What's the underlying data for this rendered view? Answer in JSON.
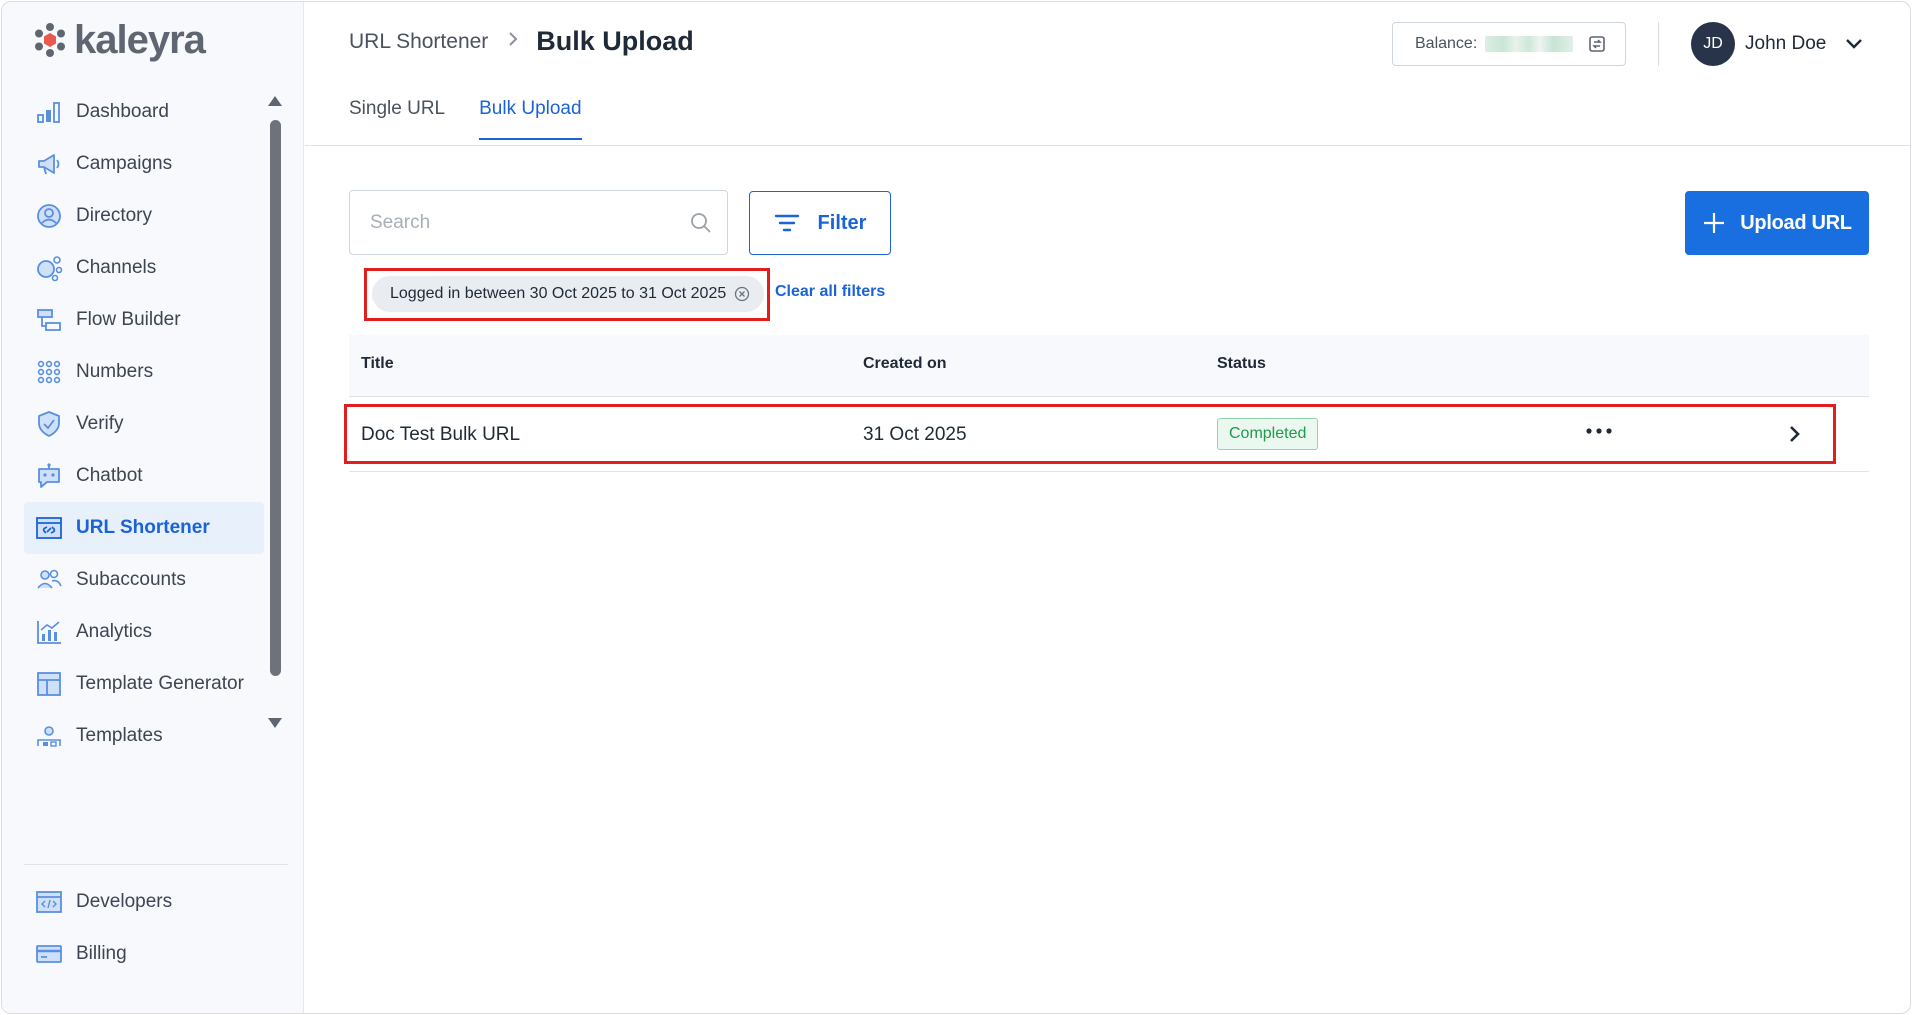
{
  "brand": {
    "name": "kaleyra",
    "color": "#5f6672",
    "accent": "#e85a4f"
  },
  "sidebar": {
    "items": [
      {
        "label": "Dashboard",
        "icon": "bar-chart-icon"
      },
      {
        "label": "Campaigns",
        "icon": "megaphone-icon"
      },
      {
        "label": "Directory",
        "icon": "user-circle-icon"
      },
      {
        "label": "Channels",
        "icon": "channels-icon"
      },
      {
        "label": "Flow Builder",
        "icon": "flow-icon"
      },
      {
        "label": "Numbers",
        "icon": "keypad-icon"
      },
      {
        "label": "Verify",
        "icon": "shield-check-icon"
      },
      {
        "label": "Chatbot",
        "icon": "chatbot-icon"
      },
      {
        "label": "URL Shortener",
        "icon": "link-window-icon",
        "active": true
      },
      {
        "label": "Subaccounts",
        "icon": "users-icon"
      },
      {
        "label": "Analytics",
        "icon": "analytics-icon"
      },
      {
        "label": "Template Generator",
        "icon": "layout-icon"
      },
      {
        "label": "Templates",
        "icon": "templates-icon"
      }
    ],
    "bottom_items": [
      {
        "label": "Developers",
        "icon": "code-window-icon"
      },
      {
        "label": "Billing",
        "icon": "credit-card-icon"
      }
    ]
  },
  "header": {
    "breadcrumb_parent": "URL Shortener",
    "breadcrumb_current": "Bulk Upload",
    "balance_label": "Balance:",
    "user_initials": "JD",
    "user_name": "John Doe"
  },
  "tabs": [
    {
      "label": "Single URL",
      "active": false
    },
    {
      "label": "Bulk Upload",
      "active": true
    }
  ],
  "toolbar": {
    "search_placeholder": "Search",
    "filter_label": "Filter",
    "upload_label": "Upload URL"
  },
  "filters": {
    "chip_label": "Logged in between 30 Oct 2025 to 31 Oct 2025",
    "clear_all_label": "Clear all filters"
  },
  "table": {
    "columns": [
      "Title",
      "Created on",
      "Status"
    ],
    "rows": [
      {
        "title": "Doc Test Bulk URL",
        "created_on": "31 Oct 2025",
        "status": "Completed"
      }
    ]
  },
  "colors": {
    "primary": "#1a63d8",
    "highlight": "#e01e1e",
    "status_completed": "#1f9a4e"
  }
}
